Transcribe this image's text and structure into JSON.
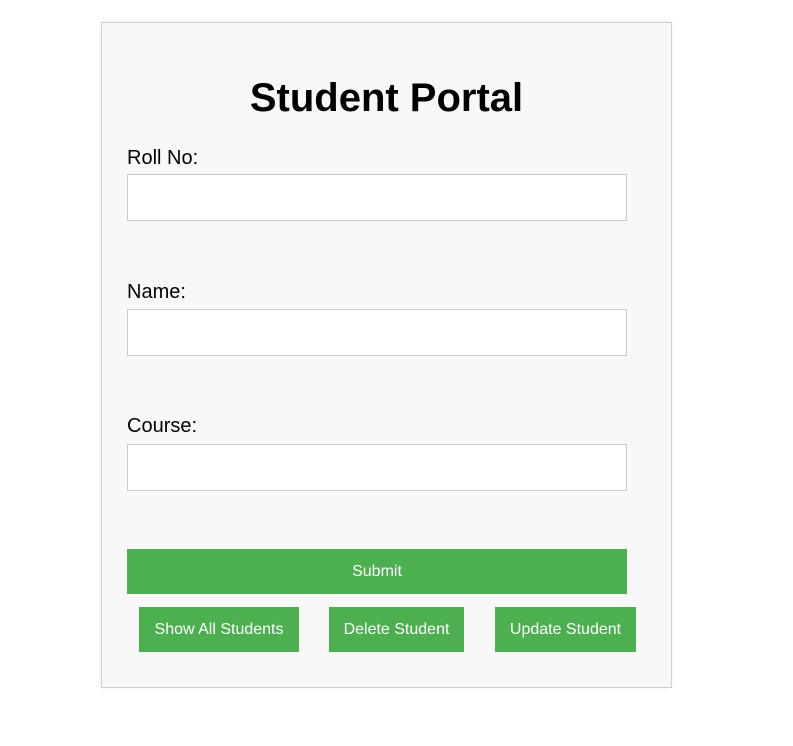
{
  "page": {
    "title": "Student Portal"
  },
  "form": {
    "roll_no": {
      "label": "Roll No:",
      "value": ""
    },
    "name": {
      "label": "Name:",
      "value": ""
    },
    "course": {
      "label": "Course:",
      "value": ""
    }
  },
  "actions": {
    "submit_label": "Submit",
    "show_all_label": "Show All Students",
    "delete_label": "Delete Student",
    "update_label": "Update Student"
  },
  "colors": {
    "accent": "#4caf50",
    "panel_bg": "#f8f8f8",
    "panel_border": "#cfcfcf",
    "button_text": "#ffffff"
  }
}
